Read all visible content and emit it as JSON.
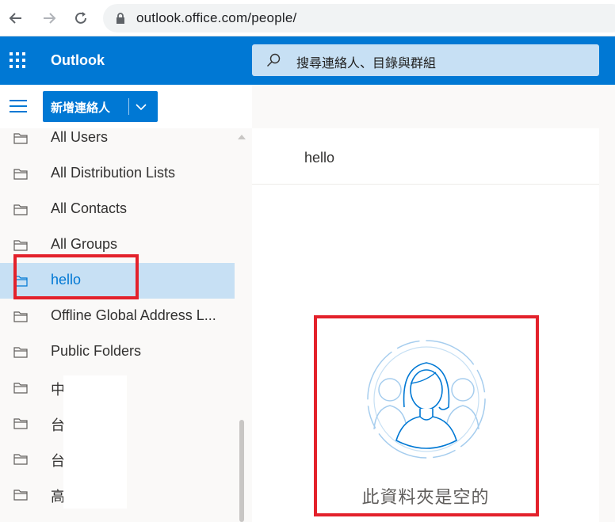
{
  "browser": {
    "url": "outlook.office.com/people/"
  },
  "header": {
    "app_name": "Outlook",
    "search_placeholder": "搜尋連絡人、目錄與群組"
  },
  "toolbar": {
    "new_contact_label": "新增連絡人"
  },
  "sidebar": {
    "folders": [
      {
        "label": "All Users",
        "selected": false
      },
      {
        "label": "All Distribution Lists",
        "selected": false
      },
      {
        "label": "All Contacts",
        "selected": false
      },
      {
        "label": "All Groups",
        "selected": false
      },
      {
        "label": "hello",
        "selected": true
      },
      {
        "label": "Offline Global Address L...",
        "selected": false
      },
      {
        "label": "Public Folders",
        "selected": false
      },
      {
        "label": "中",
        "selected": false
      },
      {
        "label": "台",
        "selected": false
      },
      {
        "label": "台",
        "selected": false
      },
      {
        "label": "高",
        "selected": false
      }
    ]
  },
  "content": {
    "folder_title": "hello",
    "empty_message": "此資料夾是空的"
  },
  "colors": {
    "brand": "#0078d4",
    "search_bg": "#c7e0f4",
    "selected_bg": "#c7e0f4",
    "annotation": "#e3212b"
  }
}
